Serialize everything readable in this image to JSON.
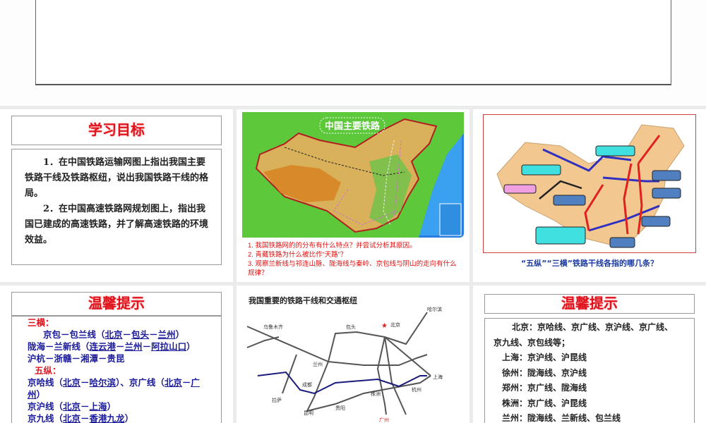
{
  "slide_top": {},
  "slide_goals": {
    "title": "学习目标",
    "items": [
      "1．在中国铁路运输网图上指出我国主要铁路干线及铁路枢纽，说出我国铁路干线的格局。",
      "2．在中国高速铁路网规划图上，指出我国已建成的高速铁路，并了解高速铁路的环境效益。"
    ]
  },
  "slide_map1": {
    "map_title": "中国主要铁路",
    "questions": [
      "1. 我国铁路网的的分布有什么特点？并尝试分析其原因。",
      "2. 青藏铁路为什么被比作“天路”？",
      "3. 观察兰新线与祁连山脉、陇海线与秦岭、京包线与阴山的走向有什么规律？"
    ]
  },
  "slide_map2": {
    "caption": "“五纵”“三横”铁路干线各指的哪几条？"
  },
  "slide_tips1": {
    "title": "温馨提示",
    "heng_label": "三横：",
    "heng": [
      {
        "name": "京包－包兰线（",
        "links": [
          "北京",
          "包头",
          "兰州"
        ],
        "end": "）"
      },
      {
        "name": "陇海－兰新线（",
        "links": [
          "连云港",
          "兰州",
          "阿拉山口"
        ],
        "end": "）"
      }
    ],
    "heng3": "沪杭－浙赣－湘潭－贵昆",
    "zong_label": "五纵：",
    "zong1": {
      "a": "京哈线（",
      "l1": "北京",
      "l2": "哈尔滨",
      "b": "）、京广线（",
      "l3": "北京",
      "l4": "广州",
      "c": "）"
    },
    "zong2": {
      "a": "京沪线（",
      "l1": "北京",
      "l2": "上海",
      "c": "）"
    },
    "zong3": {
      "a": "京九线（",
      "l1": "北京",
      "l2": "香港九龙",
      "c": "）"
    }
  },
  "slide_hubs": {
    "map_title": "我国重要的铁路干线和交通枢纽",
    "cities": [
      "北京",
      "上海",
      "兰州",
      "成都",
      "昆明",
      "贵阳",
      "广州",
      "株洲",
      "杭州",
      "拉萨",
      "哈尔滨",
      "包头",
      "乌鲁木齐"
    ]
  },
  "slide_tips2": {
    "title": "温馨提示",
    "lines": [
      "北京：京哈线、京广线、京沪线、京广线、　　京九线、京包线等；",
      "上海：京沪线、沪昆线",
      "徐州：陇海线、京沪线",
      "郑州：京广线、陇海线",
      "株洲：京广线、沪昆线",
      "兰州：陇海线、兰新线、包兰线"
    ]
  }
}
